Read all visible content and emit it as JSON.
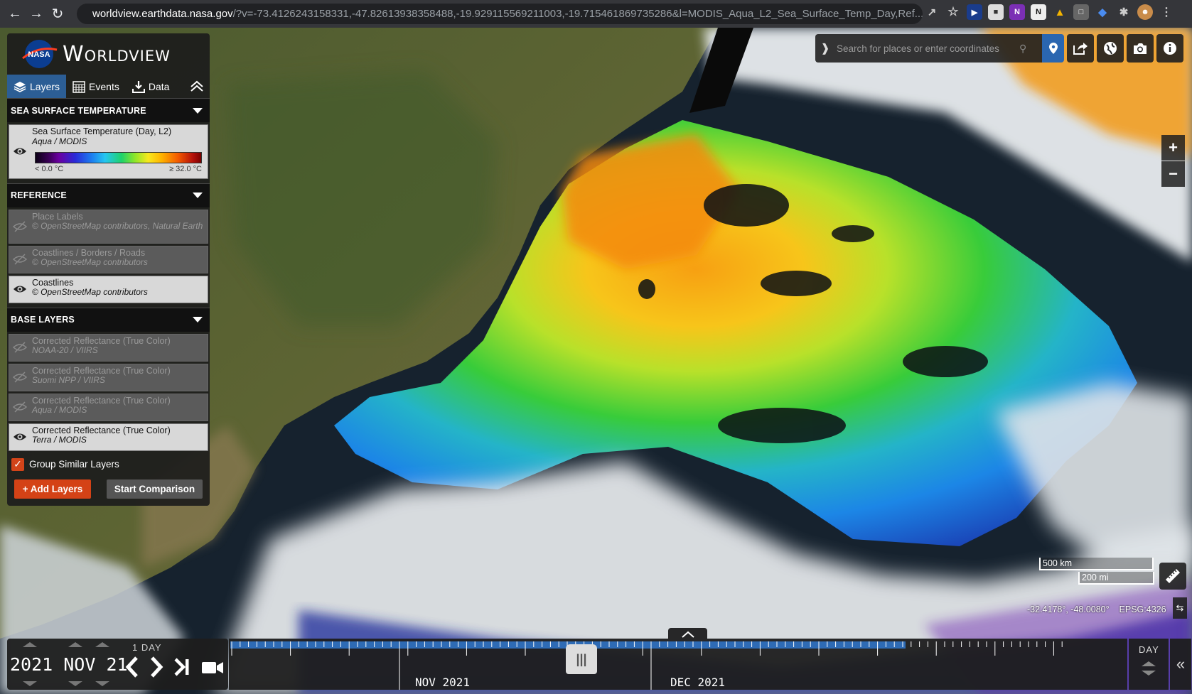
{
  "browser": {
    "url_host": "worldview.earthdata.nasa.gov",
    "url_rest": "/?v=-73.4126243158331,-47.82613938358488,-19.929115569211003,-19.715461869735286&l=MODIS_Aqua_L2_Sea_Surface_Temp_Day,Ref..."
  },
  "app": {
    "brand_logo_text": "NASA",
    "title": "Worldview"
  },
  "tabs": [
    {
      "label": "Layers",
      "icon": "layers-icon",
      "active": true
    },
    {
      "label": "Events",
      "icon": "calendar-icon",
      "active": false
    },
    {
      "label": "Data",
      "icon": "download-icon",
      "active": false
    }
  ],
  "groups": {
    "sst": {
      "title": "SEA SURFACE TEMPERATURE",
      "layers": [
        {
          "title": "Sea Surface Temperature (Day, L2)",
          "subtitle": "Aqua / MODIS",
          "visible": true,
          "legend_min": "< 0.0 °C",
          "legend_max": "≥ 32.0 °C"
        }
      ]
    },
    "reference": {
      "title": "REFERENCE",
      "layers": [
        {
          "title": "Place Labels",
          "subtitle": "© OpenStreetMap contributors, Natural Earth",
          "visible": false
        },
        {
          "title": "Coastlines / Borders / Roads",
          "subtitle": "© OpenStreetMap contributors",
          "visible": false
        },
        {
          "title": "Coastlines",
          "subtitle": "© OpenStreetMap contributors",
          "visible": true
        }
      ]
    },
    "base": {
      "title": "BASE LAYERS",
      "layers": [
        {
          "title": "Corrected Reflectance (True Color)",
          "subtitle": "NOAA-20 / VIIRS",
          "visible": false
        },
        {
          "title": "Corrected Reflectance (True Color)",
          "subtitle": "Suomi NPP / VIIRS",
          "visible": false
        },
        {
          "title": "Corrected Reflectance (True Color)",
          "subtitle": "Aqua / MODIS",
          "visible": false
        },
        {
          "title": "Corrected Reflectance (True Color)",
          "subtitle": "Terra / MODIS",
          "visible": true
        }
      ]
    }
  },
  "options": {
    "group_similar_label": "Group Similar Layers",
    "group_similar_checked": true
  },
  "buttons": {
    "add_layers": "+ Add Layers",
    "start_comparison": "Start Comparison"
  },
  "search": {
    "placeholder": "Search for places or enter coordinates"
  },
  "map": {
    "scale_km": "500 km",
    "scale_mi": "200 mi",
    "coordinates": "-32.4178°, -48.0080°",
    "projection": "EPSG:4326"
  },
  "timeline": {
    "date": "2021 NOV 21",
    "interval": "1 DAY",
    "months": [
      "NOV 2021",
      "DEC 2021"
    ],
    "zoom_level": "DAY"
  },
  "colors": {
    "accent_blue": "#2c5e95",
    "accent_orange": "#d44216",
    "timeline_blue": "#2e6bb5"
  }
}
